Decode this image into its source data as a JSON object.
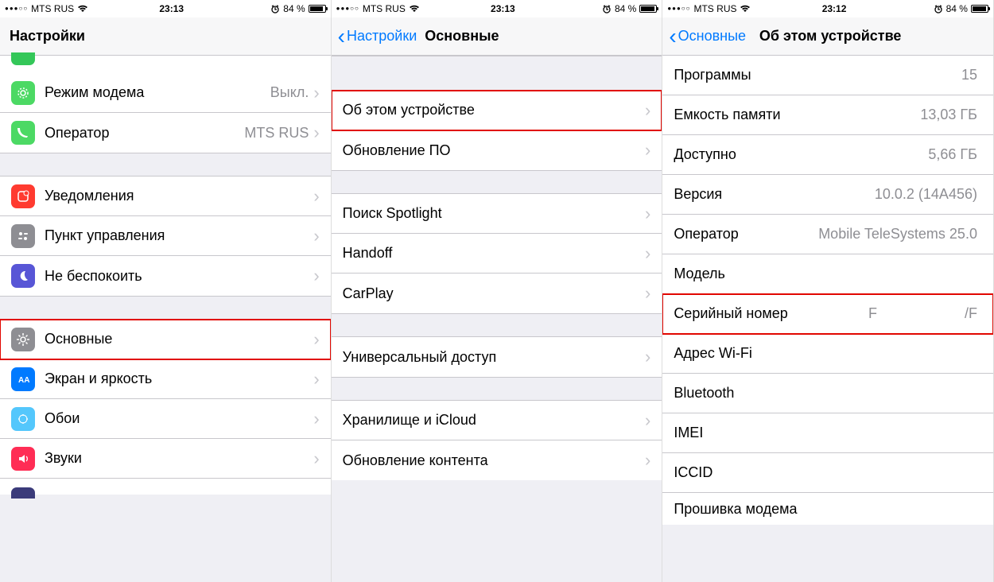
{
  "status": {
    "carrier": "MTS RUS",
    "time_left": "23:13",
    "time_mid": "23:13",
    "time_right": "23:12",
    "battery_pct": "84 %"
  },
  "screen1": {
    "title": "Настройки",
    "rows": [
      {
        "label": "Режим модема",
        "value": "Выкл."
      },
      {
        "label": "Оператор",
        "value": "MTS RUS"
      },
      {
        "label": "Уведомления"
      },
      {
        "label": "Пункт управления"
      },
      {
        "label": "Не беспокоить"
      },
      {
        "label": "Основные"
      },
      {
        "label": "Экран и яркость"
      },
      {
        "label": "Обои"
      },
      {
        "label": "Звуки"
      }
    ]
  },
  "screen2": {
    "back": "Настройки",
    "title": "Основные",
    "rows": [
      {
        "label": "Об этом устройстве"
      },
      {
        "label": "Обновление ПО"
      },
      {
        "label": "Поиск Spotlight"
      },
      {
        "label": "Handoff"
      },
      {
        "label": "CarPlay"
      },
      {
        "label": "Универсальный доступ"
      },
      {
        "label": "Хранилище и iCloud"
      },
      {
        "label": "Обновление контента"
      }
    ]
  },
  "screen3": {
    "back": "Основные",
    "title": "Об этом устройстве",
    "rows": [
      {
        "label": "Программы",
        "value": "15"
      },
      {
        "label": "Емкость памяти",
        "value": "13,03 ГБ"
      },
      {
        "label": "Доступно",
        "value": "5,66 ГБ"
      },
      {
        "label": "Версия",
        "value": "10.0.2 (14A456)"
      },
      {
        "label": "Оператор",
        "value": "Mobile TeleSystems 25.0"
      },
      {
        "label": "Модель",
        "value": ""
      },
      {
        "label": "Серийный номер",
        "value": "F                      /F"
      },
      {
        "label": "Адрес Wi-Fi",
        "value": ""
      },
      {
        "label": "Bluetooth",
        "value": ""
      },
      {
        "label": "IMEI",
        "value": ""
      },
      {
        "label": "ICCID",
        "value": ""
      },
      {
        "label": "Прошивка модема",
        "value": ""
      }
    ]
  }
}
